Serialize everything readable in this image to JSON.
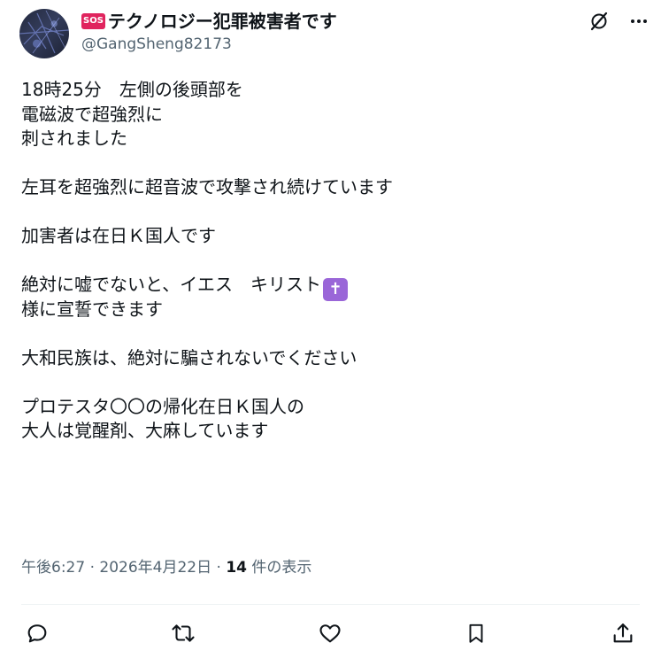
{
  "author": {
    "badge": "SOS",
    "display_name": "テクノロジー犯罪被害者です",
    "handle": "@GangSheng82173"
  },
  "post": {
    "lines": [
      "18時25分　左側の後頭部を",
      "電磁波で超強烈に",
      "刺されました",
      "",
      "左耳を超強烈に超音波で攻撃され続けています",
      "",
      "加害者は在日Ｋ国人です",
      "",
      "絶対に嘘でないと、イエス　キリスト",
      "様に宣誓できます",
      "",
      "大和民族は、絶対に騙されないでください",
      "",
      "プロテスタ〇〇の帰化在日Ｋ国人の",
      "大人は覚醒剤、大麻しています"
    ],
    "cross_emoji": "✝"
  },
  "meta": {
    "time": "午後6:27",
    "separator": "·",
    "date": "2026年4月22日",
    "views_count": "14",
    "views_label": "件の表示"
  },
  "icons": {
    "grok": "grok-icon",
    "more": "more-icon",
    "reply": "reply-icon",
    "retweet": "retweet-icon",
    "like": "like-icon",
    "bookmark": "bookmark-icon",
    "share": "share-icon"
  },
  "colors": {
    "text": "#0f1419",
    "secondary": "#536471",
    "sos_badge": "#e0245e",
    "cross_emoji_bg": "#9a66d8"
  }
}
